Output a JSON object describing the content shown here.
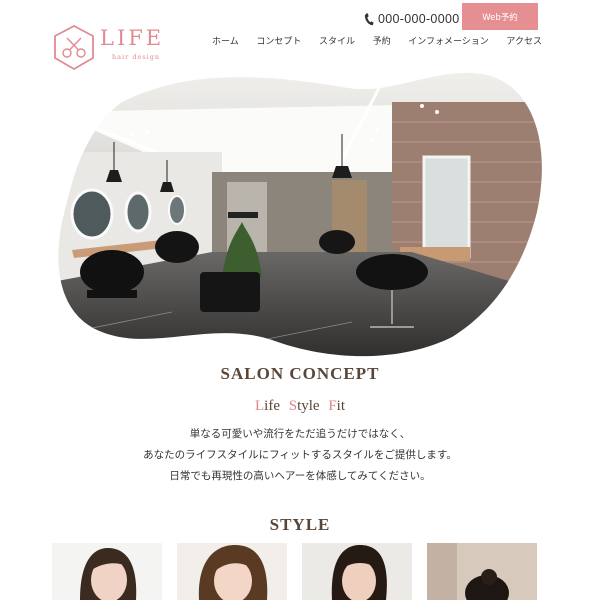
{
  "header": {
    "logo": {
      "name": "LIFE",
      "subtitle": "hair design"
    },
    "phone": "000-000-0000",
    "web_button": "Web予約",
    "nav": [
      "ホーム",
      "コンセプト",
      "スタイル",
      "予約",
      "インフォメーション",
      "アクセス"
    ]
  },
  "concept": {
    "title": "SALON CONCEPT",
    "tagline": {
      "w1_cap": "L",
      "w1_rest": "ife",
      "w2_cap": "S",
      "w2_rest": "tyle",
      "w3_cap": "F",
      "w3_rest": "it"
    },
    "lines": [
      "単なる可愛いや流行をただ追うだけではなく、",
      "あなたのライフスタイルにフィットするスタイルをご提供します。",
      "日常でも再現性の高いヘアーを体感してみてください。"
    ]
  },
  "style": {
    "title": "STYLE"
  },
  "colors": {
    "accent": "#e58f93",
    "heading": "#5a4638"
  }
}
